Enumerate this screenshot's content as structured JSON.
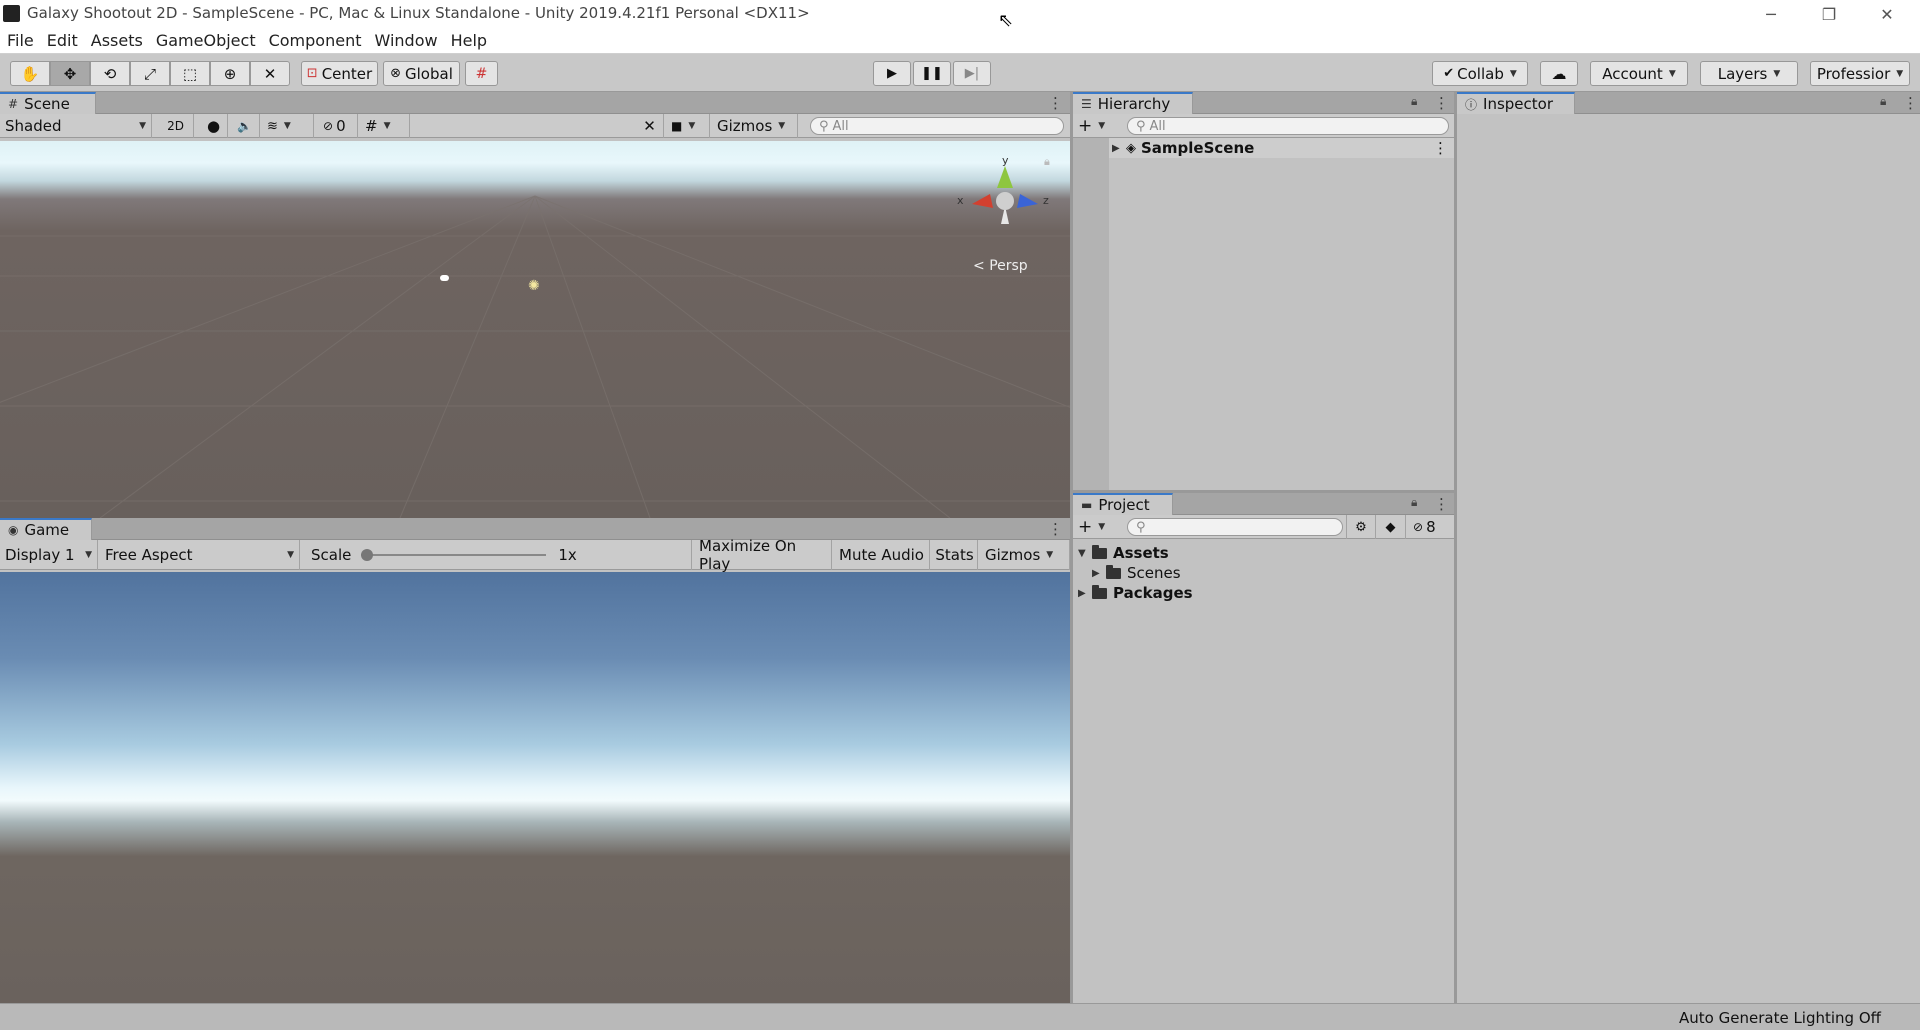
{
  "window": {
    "title": "Galaxy Shootout 2D - SampleScene - PC, Mac & Linux Standalone - Unity 2019.4.21f1 Personal <DX11>",
    "controls": {
      "minimize": "─",
      "restore": "❐",
      "close": "✕"
    }
  },
  "menubar": {
    "items": [
      "File",
      "Edit",
      "Assets",
      "GameObject",
      "Component",
      "Window",
      "Help"
    ]
  },
  "toolbar": {
    "tools": [
      "hand-icon",
      "move-icon",
      "rotate-icon",
      "scale-icon",
      "rect-icon",
      "transform-icon",
      "custom-tool-icon"
    ],
    "pivot_mode": "Center",
    "pivot_rotation": "Global",
    "collab": "Collab",
    "account": "Account",
    "layers": "Layers",
    "layout": "Professior"
  },
  "scene": {
    "tab_label": "Scene",
    "shading_mode": "Shaded",
    "mode_2d": "2D",
    "hidden_count": "0",
    "gizmos": "Gizmos",
    "search_placeholder": "All",
    "persp_label": "Persp",
    "axis_x": "x",
    "axis_y": "y",
    "axis_z": "z"
  },
  "game": {
    "tab_label": "Game",
    "display": "Display 1",
    "aspect": "Free Aspect",
    "scale_label": "Scale",
    "scale_value": "1x",
    "maximize": "Maximize On Play",
    "mute": "Mute Audio",
    "stats": "Stats",
    "gizmos": "Gizmos"
  },
  "hierarchy": {
    "tab_label": "Hierarchy",
    "search_placeholder": "All",
    "scene_name": "SampleScene"
  },
  "project": {
    "tab_label": "Project",
    "hidden_count": "8",
    "tree": {
      "assets": "Assets",
      "scenes": "Scenes",
      "packages": "Packages"
    }
  },
  "inspector": {
    "tab_label": "Inspector"
  },
  "status": {
    "text": "Auto Generate Lighting Off"
  },
  "colors": {
    "accent": "#3a79c8",
    "panel_bg": "#c2c2c2",
    "tab_bar": "#a5a5a5"
  }
}
